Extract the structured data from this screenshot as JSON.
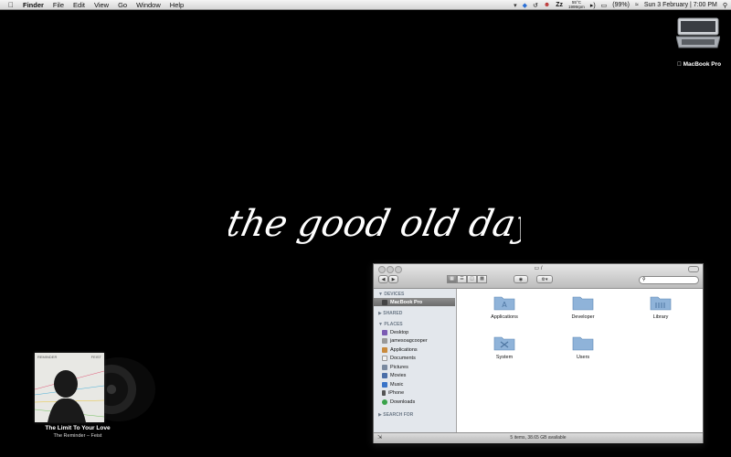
{
  "menubar": {
    "app": "Finder",
    "menus": [
      "File",
      "Edit",
      "View",
      "Go",
      "Window",
      "Help"
    ],
    "temp_top": "55°C",
    "temp_bottom": "1999rpm",
    "battery": "(99%)",
    "datetime": "Sun 3 February | 7:00 PM"
  },
  "desktop": {
    "disk_label": "MacBook Pro",
    "wallpaper_text": "the good old days"
  },
  "now_playing": {
    "album_top_left": "REMINDER",
    "album_top_right": "FEIST",
    "track": "The Limit To Your Love",
    "album_artist": "The Reminder – Feist"
  },
  "finder": {
    "title": "/",
    "sidebar": {
      "devices_header": "DEVICES",
      "device": "MacBook Pro",
      "shared_header": "SHARED",
      "places_header": "PLACES",
      "places": [
        "Desktop",
        "jamesoagcooper",
        "Applications",
        "Documents",
        "Pictures",
        "Movies",
        "Music",
        "iPhone",
        "Downloads"
      ],
      "search_header": "SEARCH FOR"
    },
    "items": [
      "Applications",
      "Developer",
      "Library",
      "System",
      "Users"
    ],
    "status": "5 items, 38.65 GB available"
  }
}
